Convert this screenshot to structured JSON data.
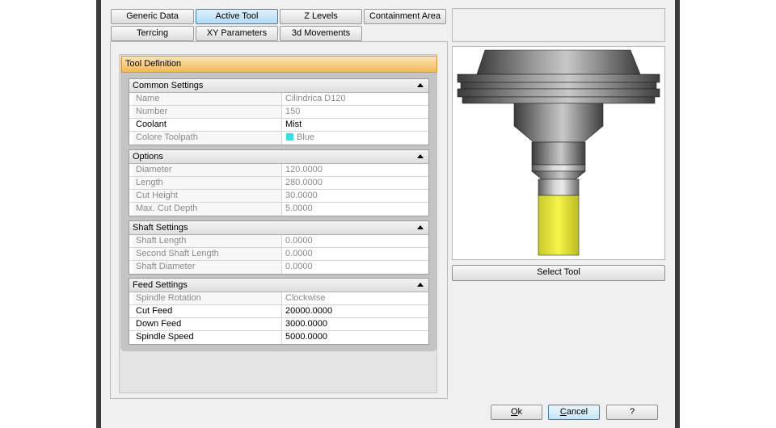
{
  "tabs": {
    "row1": [
      "Generic Data",
      "Active Tool",
      "Z Levels",
      "Containment Area"
    ],
    "row2": [
      "Terrcing",
      "XY Parameters",
      "3d Movements"
    ],
    "active": "Active Tool"
  },
  "tool_definition": {
    "title": "Tool Definition",
    "sections": {
      "common": {
        "title": "Common Settings",
        "rows": [
          {
            "label": "Name",
            "value": "Cilindrica D120"
          },
          {
            "label": "Number",
            "value": "150"
          },
          {
            "label": "Coolant",
            "value": "Mist"
          },
          {
            "label": "Colore Toolpath",
            "value": "Blue"
          }
        ]
      },
      "options": {
        "title": "Options",
        "rows": [
          {
            "label": "Diameter",
            "value": "120.0000"
          },
          {
            "label": "Length",
            "value": "280.0000"
          },
          {
            "label": "Cut Height",
            "value": "30.0000"
          },
          {
            "label": "Max. Cut Depth",
            "value": "5.0000"
          }
        ]
      },
      "shaft": {
        "title": "Shaft Settings",
        "rows": [
          {
            "label": "Shaft Length",
            "value": "0.0000"
          },
          {
            "label": "Second Shaft Length",
            "value": "0.0000"
          },
          {
            "label": "Shaft Diameter",
            "value": "0.0000"
          }
        ]
      },
      "feed": {
        "title": "Feed Settings",
        "rows": [
          {
            "label": "Spindle Rotation",
            "value": "Clockwise"
          },
          {
            "label": "Cut Feed",
            "value": "20000.0000"
          },
          {
            "label": "Down Feed",
            "value": "3000.0000"
          },
          {
            "label": "Spindle Speed",
            "value": "5000.0000"
          }
        ]
      }
    }
  },
  "colors": {
    "toolpath_swatch": "#33e0e8",
    "cutter": "#ecec3a",
    "header_orange": "#f3b957",
    "active_tab": "#b3dcf7"
  },
  "buttons": {
    "select_tool": "Select Tool",
    "ok": "Ok",
    "ok_mnemonic": "O",
    "ok_rest": "k",
    "cancel": "Cancel",
    "cancel_mnemonic": "C",
    "cancel_rest": "ancel",
    "help": "?"
  }
}
